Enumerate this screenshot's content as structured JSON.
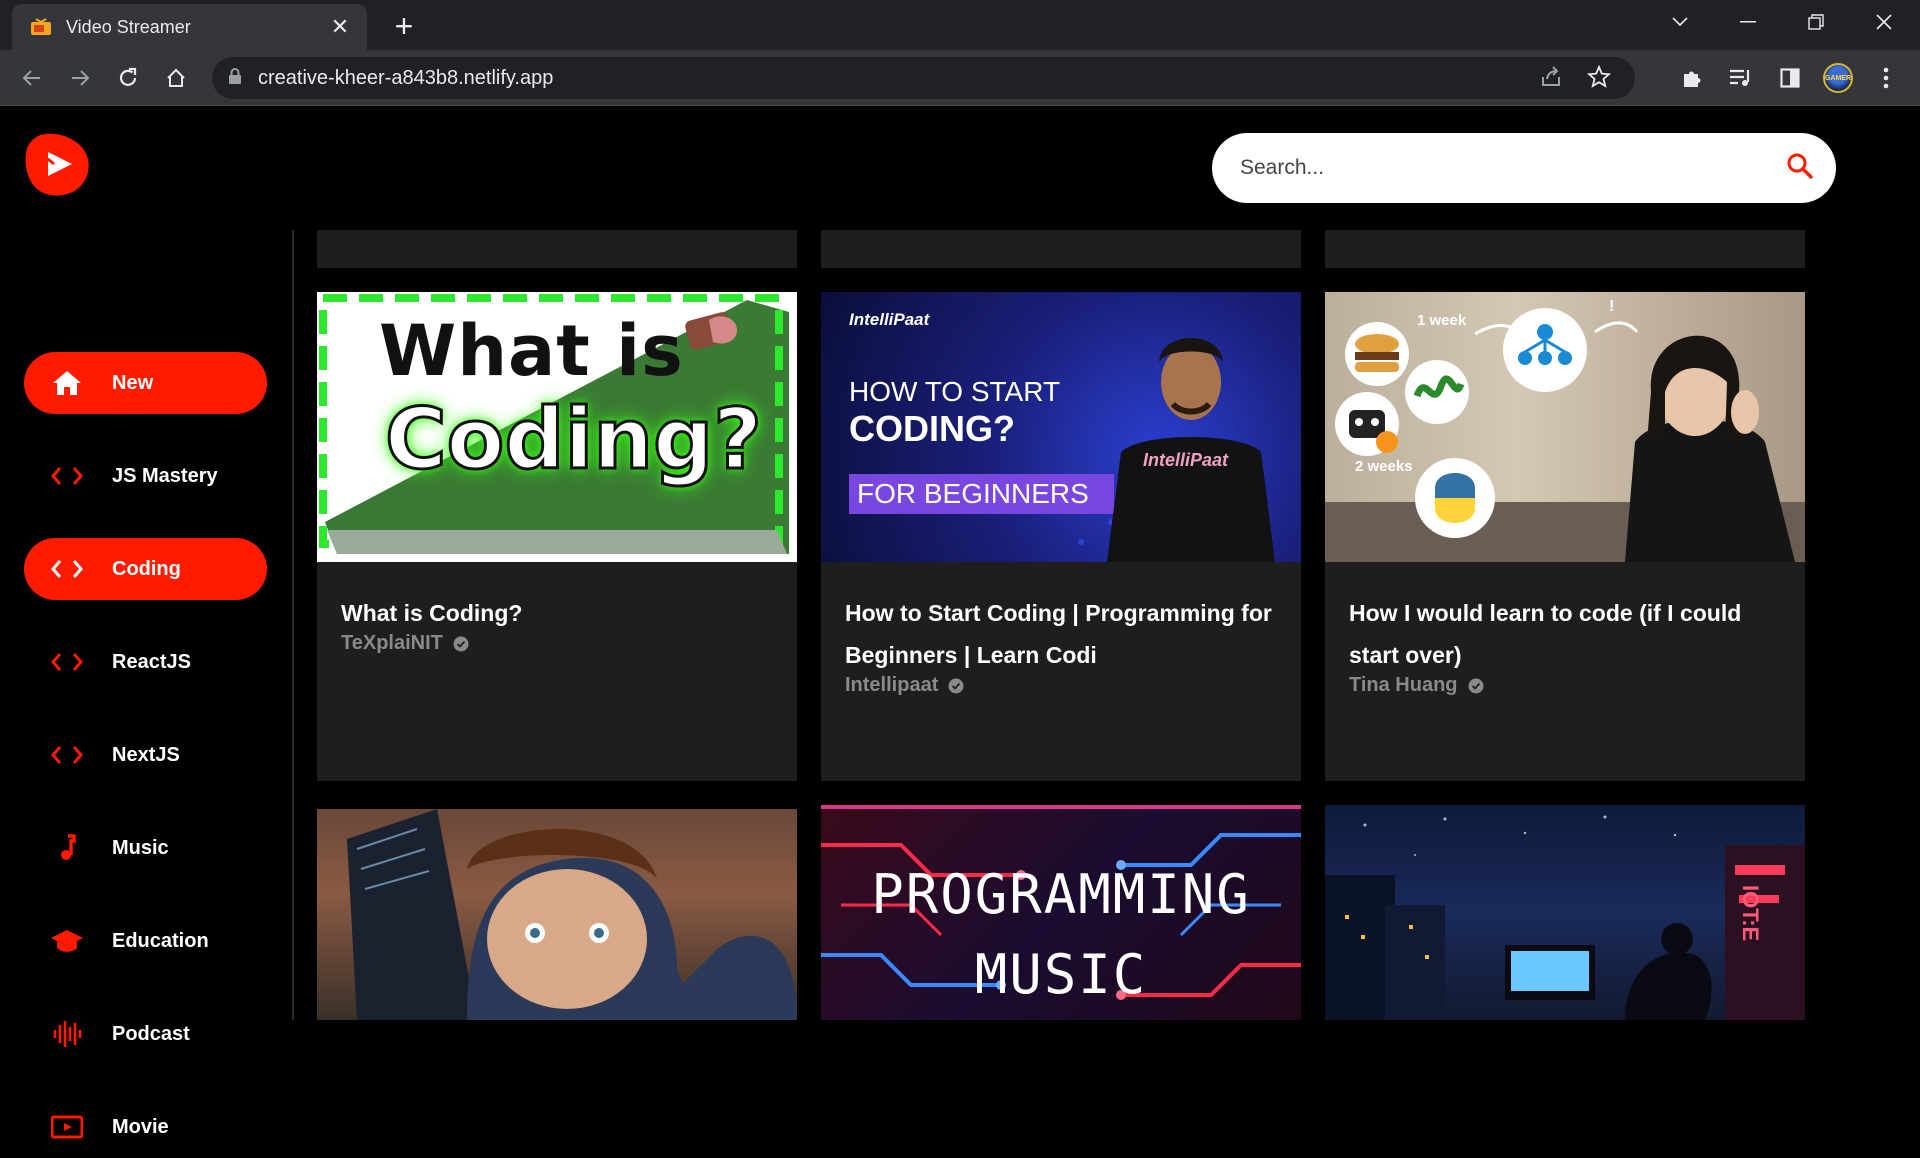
{
  "browser": {
    "tab_title": "Video Streamer",
    "url": "creative-kheer-a843b8.netlify.app",
    "profile_badge": "GAMER"
  },
  "app": {
    "search_placeholder": "Search...",
    "accent_color": "#ff1a00"
  },
  "sidebar": {
    "items": [
      {
        "label": "New",
        "icon": "home-icon",
        "active": true
      },
      {
        "label": "JS Mastery",
        "icon": "code-icon",
        "active": false
      },
      {
        "label": "Coding",
        "icon": "code-icon",
        "active": true
      },
      {
        "label": "ReactJS",
        "icon": "code-icon",
        "active": false
      },
      {
        "label": "NextJS",
        "icon": "code-icon",
        "active": false
      },
      {
        "label": "Music",
        "icon": "music-note-icon",
        "active": false
      },
      {
        "label": "Education",
        "icon": "graduation-cap-icon",
        "active": false
      },
      {
        "label": "Podcast",
        "icon": "soundwave-icon",
        "active": false
      },
      {
        "label": "Movie",
        "icon": "movie-icon",
        "active": false
      }
    ]
  },
  "videos": [
    {
      "title": "What is Coding?",
      "channel": "TeXplaiNIT",
      "thumb_text": [
        "What is",
        "Coding?"
      ]
    },
    {
      "title": "How to Start Coding | Programming for Beginners | Learn Codi",
      "channel": "Intellipaat",
      "thumb_text": [
        "IntelliPaat",
        "HOW TO START",
        "CODING?",
        "FOR BEGINNERS",
        "IntelliPaat"
      ]
    },
    {
      "title": "How I would learn to code (if I could start over)",
      "channel": "Tina Huang",
      "thumb_text": [
        "1 week",
        "2 weeks",
        "!"
      ]
    },
    {
      "title": "",
      "channel": "",
      "thumb_text": []
    },
    {
      "title": "",
      "channel": "",
      "thumb_text": [
        "PROGRAMMING",
        "MUSIC"
      ]
    },
    {
      "title": "",
      "channel": "",
      "thumb_text": [
        "IOT:E"
      ]
    }
  ]
}
